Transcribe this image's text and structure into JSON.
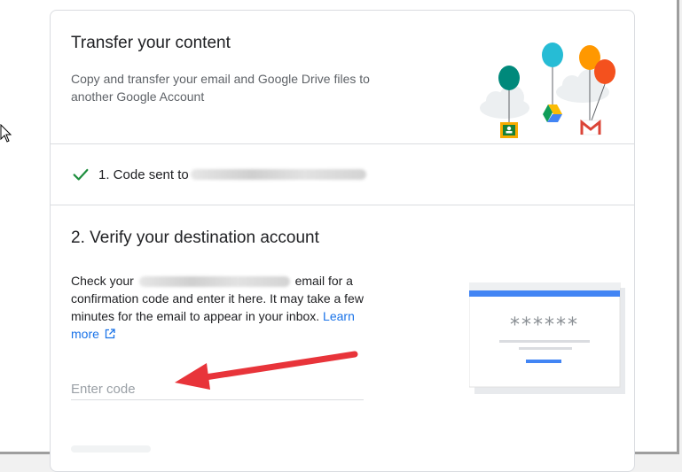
{
  "header": {
    "title": "Transfer your content",
    "description": "Copy and transfer your email and Google Drive files to another Google Account"
  },
  "step1": {
    "label": "1. Code sent to",
    "status_icon": "check-icon",
    "status_color": "#1e8e3e"
  },
  "step2": {
    "title": "2. Verify your destination account",
    "text_before": "Check your",
    "text_after": "email for a confirmation code and enter it here. It may take a few minutes for the email to appear in your inbox.",
    "link_label": "Learn more",
    "link_icon": "external-link-icon",
    "code_placeholder": "Enter code",
    "password_mask": "******"
  },
  "colors": {
    "accent": "#1a73e8",
    "annotation_arrow": "#e8343a"
  },
  "illustration": {
    "icons": [
      "google-classroom-icon",
      "google-drive-icon",
      "gmail-icon"
    ]
  }
}
